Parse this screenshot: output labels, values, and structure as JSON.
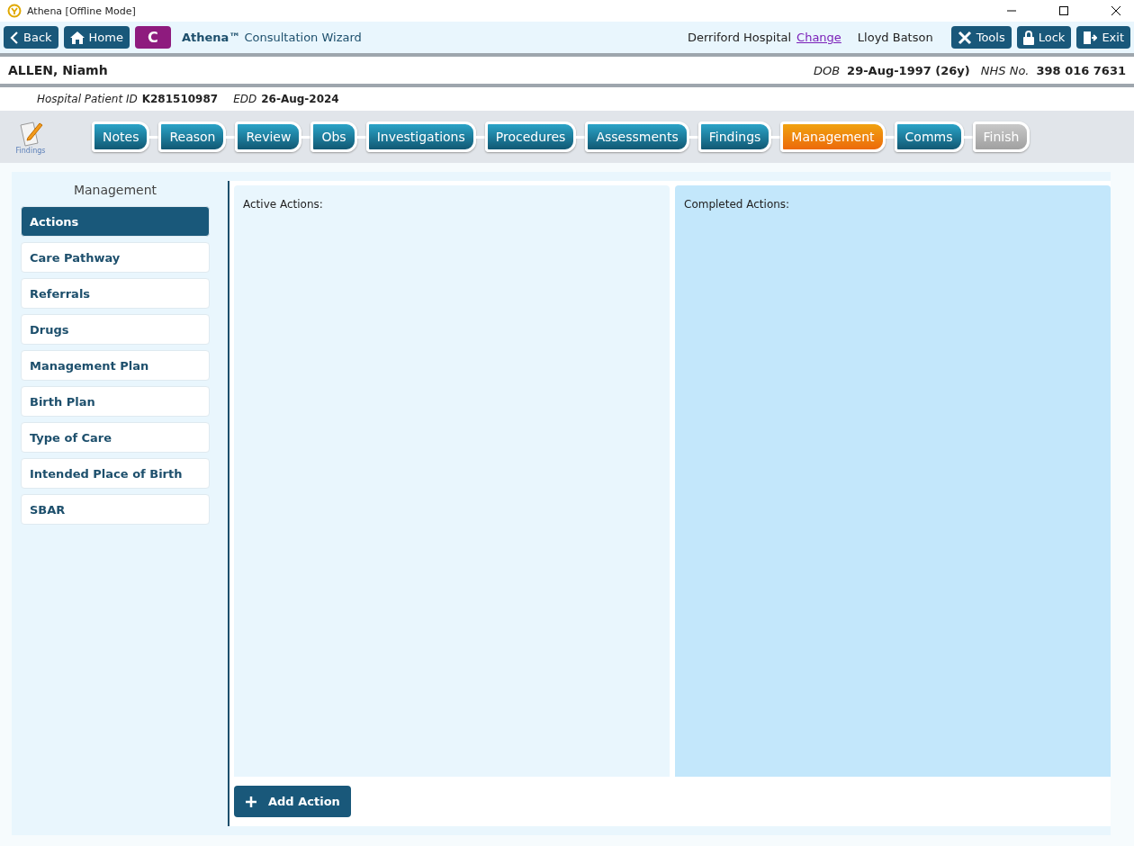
{
  "window": {
    "title": "Athena [Offline Mode]"
  },
  "toolbar": {
    "back": "Back",
    "home": "Home",
    "badge": "C",
    "title": "**Athena™** Consultation Wizard",
    "location": "Derriford Hospital",
    "change_link": "Change",
    "user": "Lloyd Batson",
    "tools": "Tools",
    "lock": "Lock",
    "exit": "Exit"
  },
  "patient": {
    "name": "ALLEN, Niamh",
    "dob_label": "DOB",
    "dob": "29-Aug-1997 (26y)",
    "nhs_label": "NHS No.",
    "nhs": "398 016 7631",
    "hospital_id_label": "Hospital Patient ID",
    "hospital_id": "K281510987",
    "edd_label": "EDD",
    "edd": "26-Aug-2024"
  },
  "section_icon_label": "Findings",
  "steps": [
    {
      "label": "Notes",
      "selected": false,
      "disabled": false
    },
    {
      "label": "Reason",
      "selected": false,
      "disabled": false
    },
    {
      "label": "Review",
      "selected": false,
      "disabled": false
    },
    {
      "label": "Obs",
      "selected": false,
      "disabled": false
    },
    {
      "label": "Investigations",
      "selected": false,
      "disabled": false
    },
    {
      "label": "Procedures",
      "selected": false,
      "disabled": false
    },
    {
      "label": "Assessments",
      "selected": false,
      "disabled": false
    },
    {
      "label": "Findings",
      "selected": false,
      "disabled": false
    },
    {
      "label": "Management",
      "selected": true,
      "disabled": false
    },
    {
      "label": "Comms",
      "selected": false,
      "disabled": false
    },
    {
      "label": "Finish",
      "selected": false,
      "disabled": true
    }
  ],
  "sidebar": {
    "title": "Management",
    "items": [
      {
        "label": "Actions",
        "selected": true
      },
      {
        "label": "Care Pathway",
        "selected": false
      },
      {
        "label": "Referrals",
        "selected": false
      },
      {
        "label": "Drugs",
        "selected": false
      },
      {
        "label": "Management Plan",
        "selected": false
      },
      {
        "label": "Birth Plan",
        "selected": false
      },
      {
        "label": "Type of Care",
        "selected": false
      },
      {
        "label": "Intended Place of Birth",
        "selected": false
      },
      {
        "label": "SBAR",
        "selected": false
      }
    ]
  },
  "panels": {
    "active_title": "Active Actions:",
    "completed_title": "Completed Actions:"
  },
  "add_button": "Add Action"
}
